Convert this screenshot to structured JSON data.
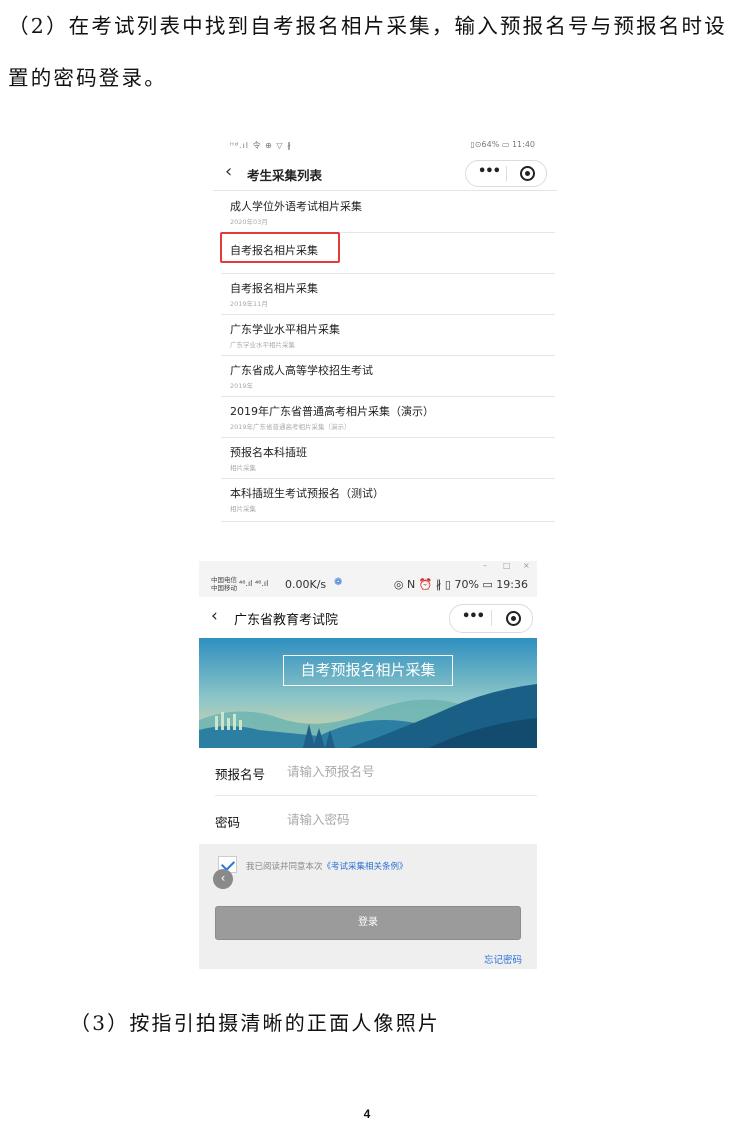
{
  "step2_text": "（2）在考试列表中找到自考报名相片采集，输入预报名号与预报名时设置的密码登录。",
  "step3_text": "（3）按指引拍摄清晰的正面人像照片",
  "page_number": "4",
  "screenshot1": {
    "status_left": "ᴴᵈ.ıl 令 ⊕ ▽ ∦",
    "status_right": "▯⊙64% ▭ 11:40",
    "back_icon": "chevron-left-icon",
    "title": "考生采集列表",
    "more": "•••",
    "items": [
      {
        "title": "成人学位外语考试相片采集",
        "sub": "2020年03月"
      },
      {
        "title": "自考报名相片采集",
        "sub": ""
      },
      {
        "title": "自考报名相片采集",
        "sub": "2019年11月"
      },
      {
        "title": "广东学业水平相片采集",
        "sub": "广东学业水平相片采集"
      },
      {
        "title": "广东省成人高等学校招生考试",
        "sub": "2019年"
      },
      {
        "title": "2019年广东省普通高考相片采集（演示）",
        "sub": "2019年广东省普通高考相片采集（演示）"
      },
      {
        "title": "预报名本科插班",
        "sub": "相片采集"
      },
      {
        "title": "本科插班生考试预报名（测试）",
        "sub": "相片采集"
      }
    ],
    "highlight_color": "#e23b3b"
  },
  "screenshot2": {
    "window_controls": [
      "–",
      "□",
      "×"
    ],
    "carrier_line1": "中国电信",
    "carrier_line2": "中国移动",
    "signal": "⁴⁶.ıl ⁴⁶.ıl",
    "speed": "0.00K/s",
    "status_right": "◎ N ⏰ ∦ ▯ 70% ▭ 19:36",
    "title": "广东省教育考试院",
    "more": "•••",
    "banner_title": "自考预报名相片采集",
    "fields": [
      {
        "label": "预报名号",
        "placeholder": "请输入预报名号"
      },
      {
        "label": "密码",
        "placeholder": "请输入密码"
      }
    ],
    "agree_text": "我已阅读并同意本次",
    "agree_link": "《考试采集相关条例》",
    "login_label": "登录",
    "forgot_label": "忘记密码",
    "accent_color": "#2a6fd6"
  }
}
